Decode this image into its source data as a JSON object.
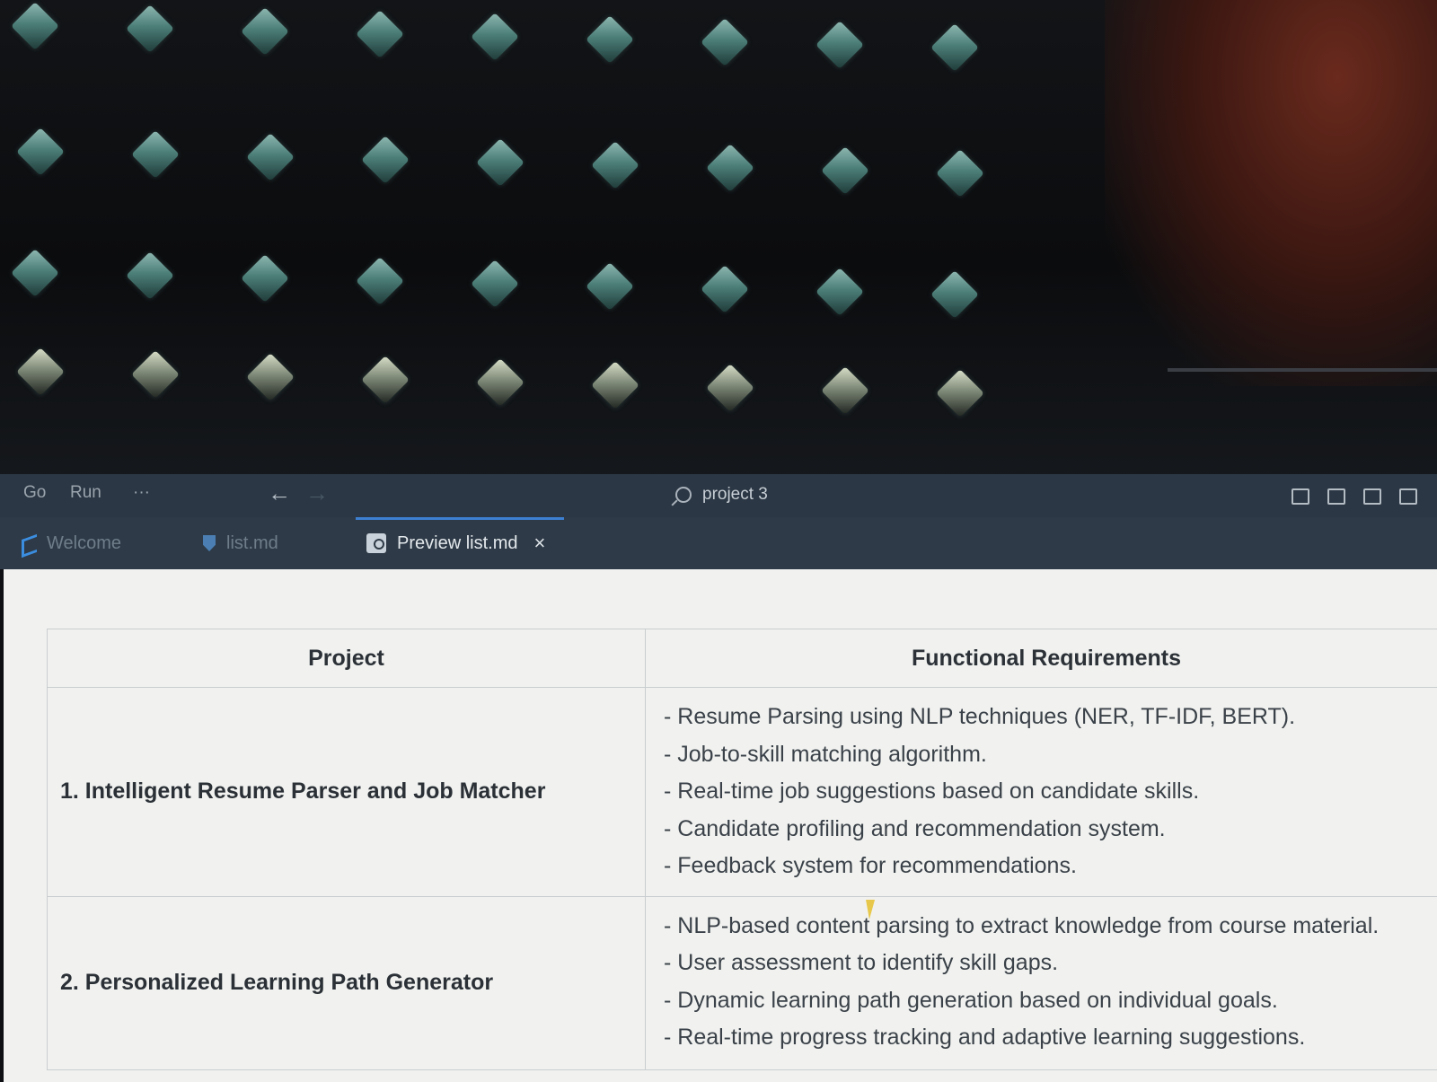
{
  "titlebar": {
    "menu": [
      "Go",
      "Run",
      "···"
    ],
    "back_arrow": "←",
    "forward_arrow": "→",
    "search_text": "project 3"
  },
  "tabs": [
    {
      "label": "Welcome",
      "icon": "vscode-icon",
      "active": false
    },
    {
      "label": "list.md",
      "icon": "markdown-icon",
      "active": false
    },
    {
      "label": "Preview list.md",
      "icon": "preview-icon",
      "active": true,
      "close": "×"
    }
  ],
  "table": {
    "headers": [
      "Project",
      "Functional Requirements"
    ],
    "rows": [
      {
        "project": "1. Intelligent Resume Parser and Job Matcher",
        "requirements": [
          "- Resume Parsing using NLP techniques (NER, TF-IDF, BERT).",
          "- Job-to-skill matching algorithm.",
          "- Real-time job suggestions based on candidate skills.",
          "- Candidate profiling and recommendation system.",
          "- Feedback system for recommendations."
        ]
      },
      {
        "project": "2. Personalized Learning Path Generator",
        "requirements": [
          "- NLP-based content parsing to extract knowledge from course material.",
          "- User assessment to identify skill gaps.",
          "- Dynamic learning path generation based on individual goals.",
          "- Real-time progress tracking and adaptive learning suggestions."
        ]
      }
    ]
  },
  "colors": {
    "titlebar_bg": "#2b3744",
    "tabbar_bg": "#2e3a47",
    "active_tab_accent": "#3d7fd1",
    "editor_bg": "#f1f2f0"
  }
}
